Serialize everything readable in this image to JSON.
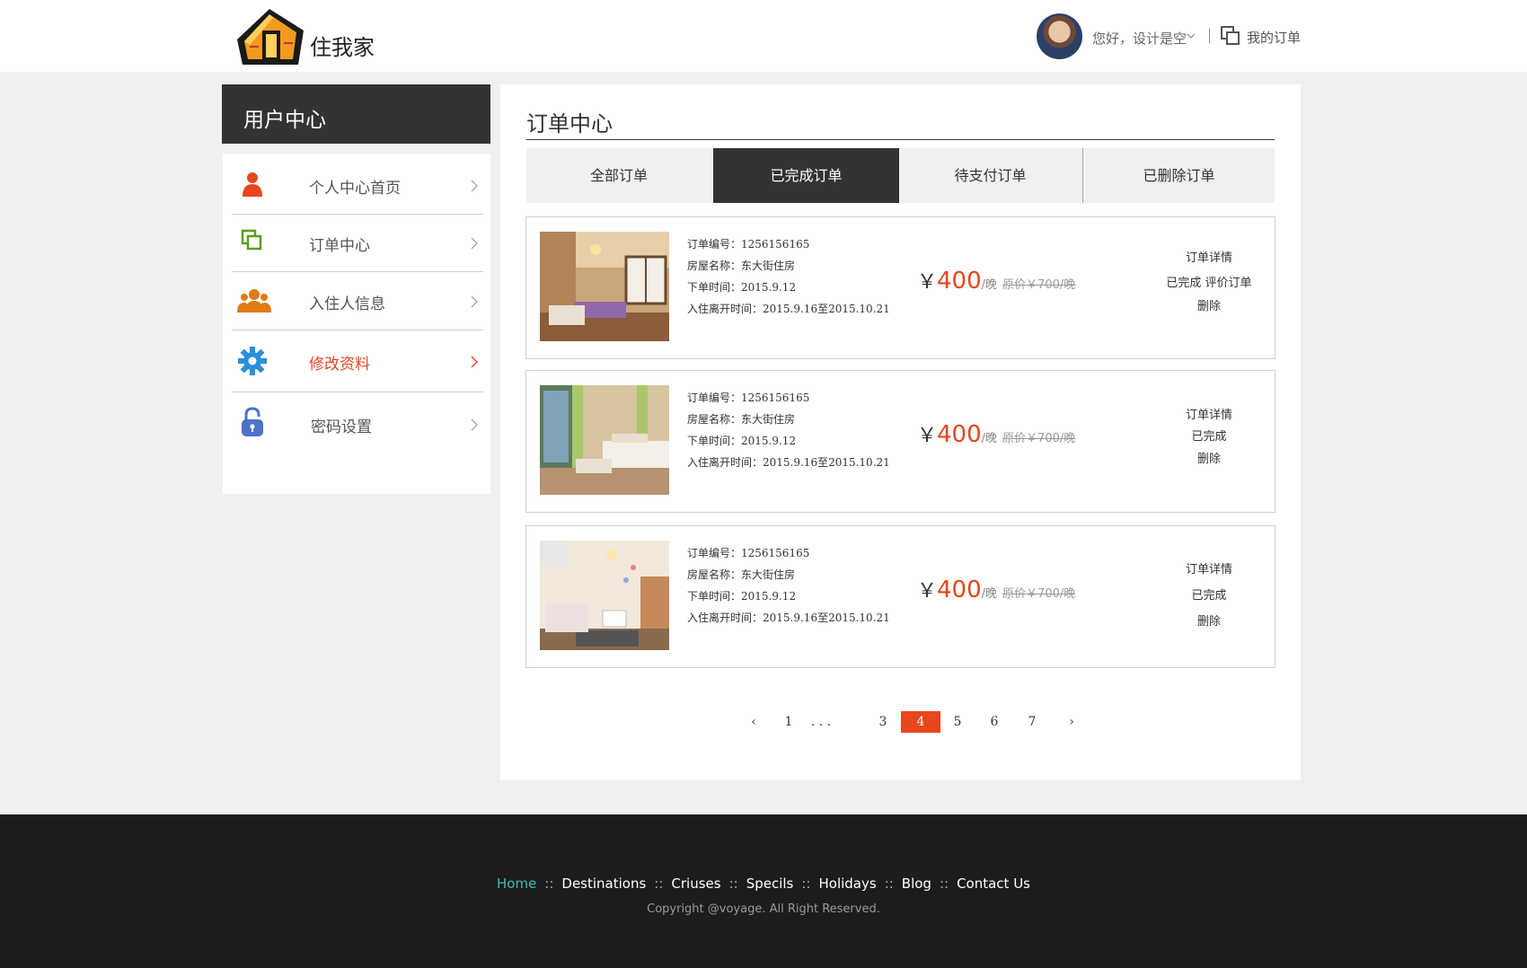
{
  "header": {
    "logo_text": "住我家",
    "greeting": "您好，设计是空",
    "my_orders": "我的订单"
  },
  "sidebar": {
    "title": "用户中心",
    "items": [
      {
        "label": "个人中心首页",
        "icon": "person-icon"
      },
      {
        "label": "订单中心",
        "icon": "orders-icon"
      },
      {
        "label": "入住人信息",
        "icon": "people-icon"
      },
      {
        "label": "修改资料",
        "icon": "gear-icon",
        "active": true
      },
      {
        "label": "密码设置",
        "icon": "lock-icon"
      }
    ]
  },
  "main": {
    "title": "订单中心",
    "tabs": [
      {
        "label": "全部订单"
      },
      {
        "label": "已完成订单",
        "active": true
      },
      {
        "label": "待支付订单"
      },
      {
        "label": "已删除订单"
      }
    ],
    "orders": [
      {
        "order_no": "订单编号：1256156165",
        "room": "房屋名称：东大街住房",
        "time": "下单时间：2015.9.12",
        "stay": "入住离开时间：2015.9.16至2015.10.21",
        "currency": "￥",
        "price": "400",
        "unit": "/晚",
        "original": "原价￥700/晚",
        "actions": [
          "订单详情",
          "已完成  评价订单",
          "删除"
        ]
      },
      {
        "order_no": "订单编号：1256156165",
        "room": "房屋名称：东大街住房",
        "time": "下单时间：2015.9.12",
        "stay": "入住离开时间：2015.9.16至2015.10.21",
        "currency": "￥",
        "price": "400",
        "unit": "/晚",
        "original": "原价￥700/晚",
        "actions": [
          "订单详情",
          "已完成",
          "删除"
        ]
      },
      {
        "order_no": "订单编号：1256156165",
        "room": "房屋名称：东大街住房",
        "time": "下单时间：2015.9.12",
        "stay": "入住离开时间：2015.9.16至2015.10.21",
        "currency": "￥",
        "price": "400",
        "unit": "/晚",
        "original": "原价￥700/晚",
        "actions": [
          "订单详情",
          "已完成",
          "删除"
        ]
      }
    ],
    "pagination": {
      "prev": "‹",
      "first": "1",
      "ellipsis": ". . .",
      "pages": [
        "3",
        "4",
        "5",
        "6",
        "7"
      ],
      "current": "4",
      "next": "›"
    }
  },
  "footer": {
    "nav": [
      "Home",
      "Destinations",
      "Criuses",
      "Specils",
      "Holidays",
      "Blog",
      "Contact Us"
    ],
    "nav_sep": "::",
    "copyright": "Copyright @voyage. All Right Reserved."
  },
  "colors": {
    "accent": "#e8461c",
    "dark": "#333333",
    "footer_bg": "#1c1c1c",
    "footer_active": "#39c0b0"
  }
}
